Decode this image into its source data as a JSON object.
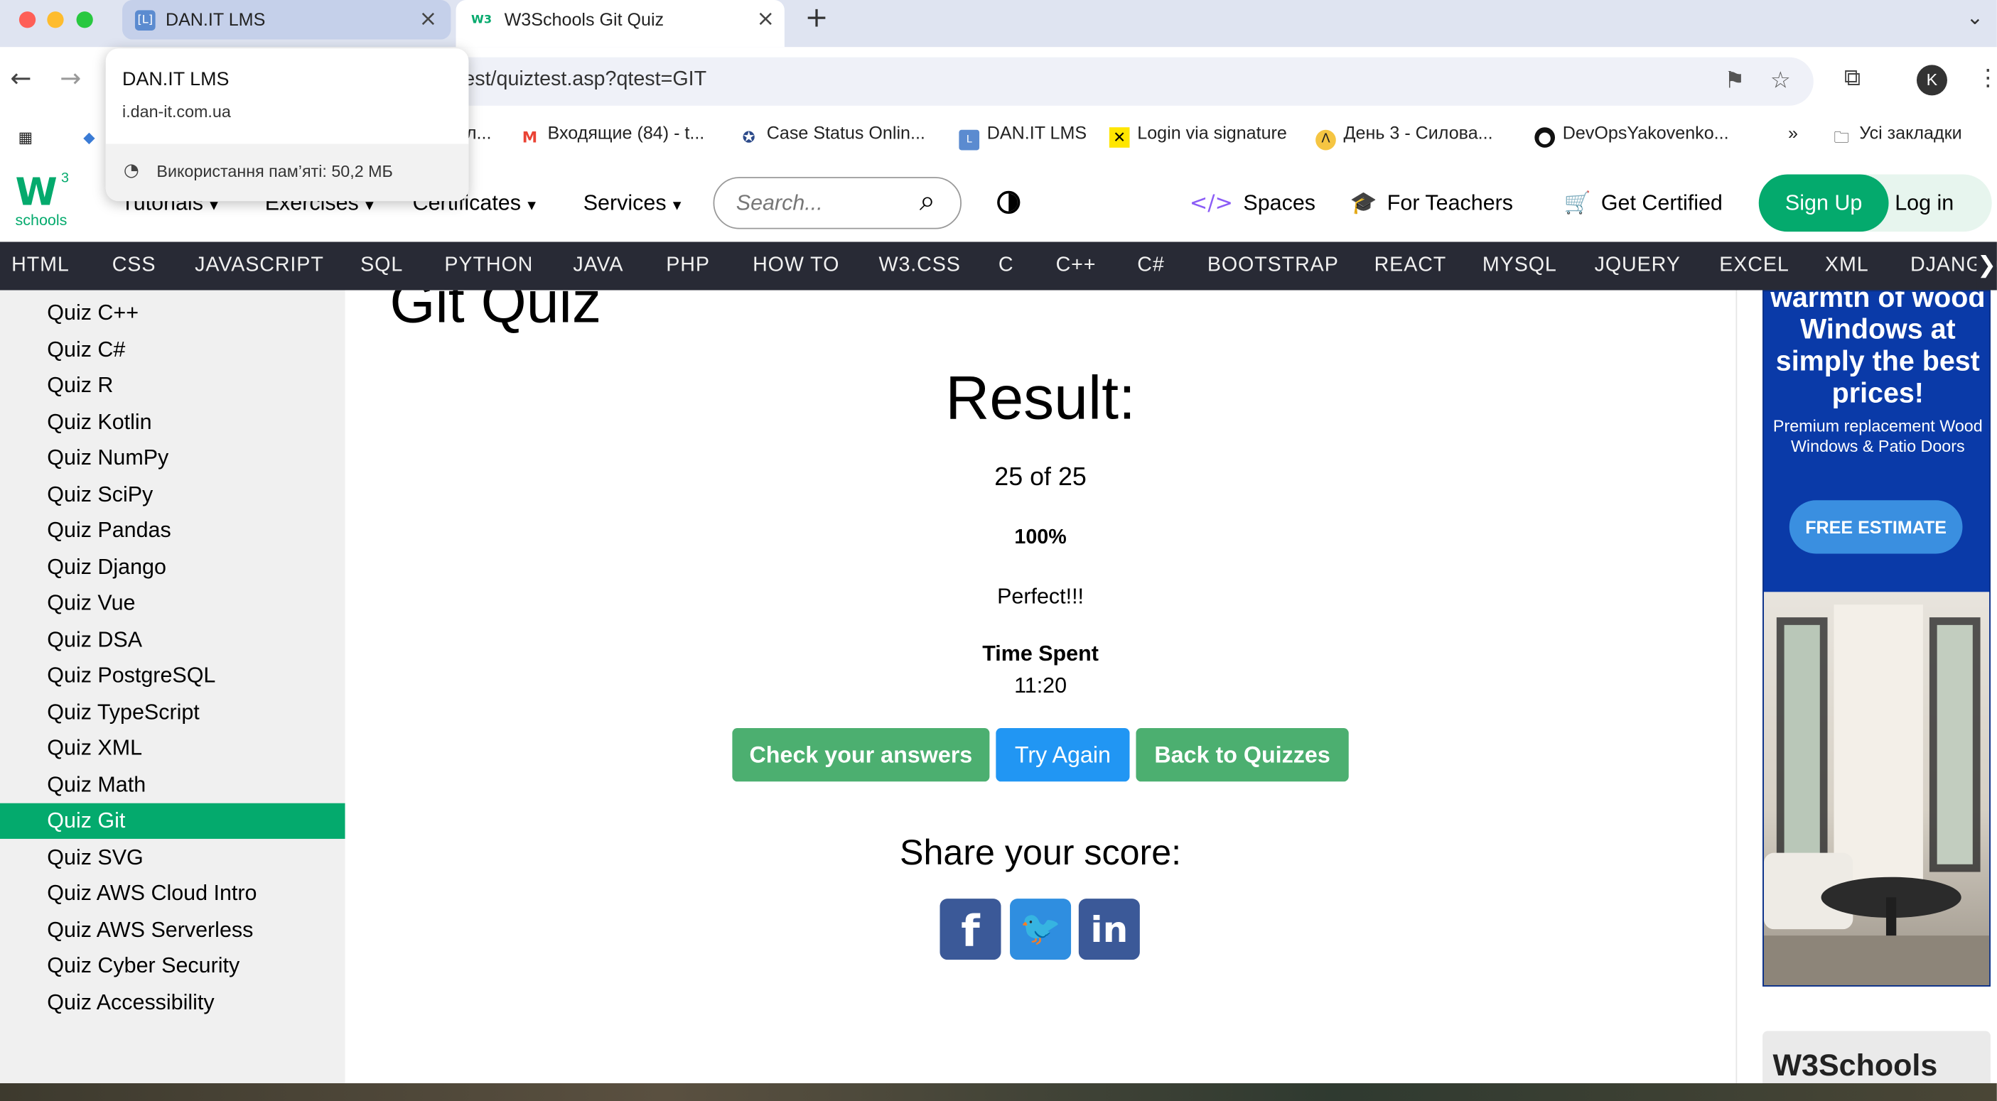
{
  "browser": {
    "tabs": [
      {
        "title": "DAN.IT LMS",
        "favicon": "[L]"
      },
      {
        "title": "W3Schools Git Quiz",
        "favicon": "W3"
      }
    ],
    "address": "est/quiztest.asp?qtest=GIT",
    "profile_initial": "K",
    "bookmarks": [
      {
        "label": "л...",
        "icon": "lms-icon"
      },
      {
        "label": "Входящие (84) - t...",
        "icon": "gmail-icon"
      },
      {
        "label": "Case Status Onlin...",
        "icon": "seal-icon"
      },
      {
        "label": "DAN.IT LMS",
        "icon": "lms-icon"
      },
      {
        "label": "Login via signature",
        "icon": "raiffeisen-icon"
      },
      {
        "label": "День 3 - Силова...",
        "icon": "coin-icon"
      },
      {
        "label": "DevOpsYakovenko...",
        "icon": "github-icon"
      }
    ],
    "all_bookmarks": "Усі закладки",
    "hover_card": {
      "title": "DAN.IT LMS",
      "url": "i.dan-it.com.ua",
      "memory": "Використання пам’яті: 50,2 МБ"
    }
  },
  "header": {
    "logo_text": "schools",
    "logo_mark": "W",
    "logo_sup": "3",
    "menus": [
      "Tutorials",
      "Exercises",
      "Certificates",
      "Services"
    ],
    "search_placeholder": "Search...",
    "links": [
      "Spaces",
      "For Teachers",
      "Get Certified"
    ],
    "signup": "Sign Up",
    "login": "Log in"
  },
  "topnav": [
    "HTML",
    "CSS",
    "JAVASCRIPT",
    "SQL",
    "PYTHON",
    "JAVA",
    "PHP",
    "HOW TO",
    "W3.CSS",
    "C",
    "C++",
    "C#",
    "BOOTSTRAP",
    "REACT",
    "MYSQL",
    "JQUERY",
    "EXCEL",
    "XML",
    "DJANGO"
  ],
  "sidebar": {
    "items": [
      "Quiz C++",
      "Quiz C#",
      "Quiz R",
      "Quiz Kotlin",
      "Quiz NumPy",
      "Quiz SciPy",
      "Quiz Pandas",
      "Quiz Django",
      "Quiz Vue",
      "Quiz DSA",
      "Quiz PostgreSQL",
      "Quiz TypeScript",
      "Quiz XML",
      "Quiz Math",
      "Quiz Git",
      "Quiz SVG",
      "Quiz AWS Cloud Intro",
      "Quiz AWS Serverless",
      "Quiz Cyber Security",
      "Quiz Accessibility"
    ],
    "active": "Quiz Git"
  },
  "main": {
    "title": "Git Quiz",
    "result_heading": "Result:",
    "score": "25 of 25",
    "percent": "100%",
    "message": "Perfect!!!",
    "time_label": "Time Spent",
    "time_value": "11:20",
    "buttons": {
      "check": "Check your answers",
      "try_again": "Try Again",
      "back": "Back to Quizzes"
    },
    "share_heading": "Share your score:"
  },
  "ad": {
    "headline": "warmth of wood Windows at simply the best prices!",
    "sub": "Premium replacement Wood Windows & Patio Doors",
    "cta": "FREE ESTIMATE"
  },
  "w3card": "W3Schools",
  "colors": {
    "brand_green": "#04aa6d",
    "try_again_blue": "#2196f3",
    "topnav_bg": "#282a35",
    "sidebar_bg": "#f0f0f0",
    "share_blue": "#3b5998"
  }
}
